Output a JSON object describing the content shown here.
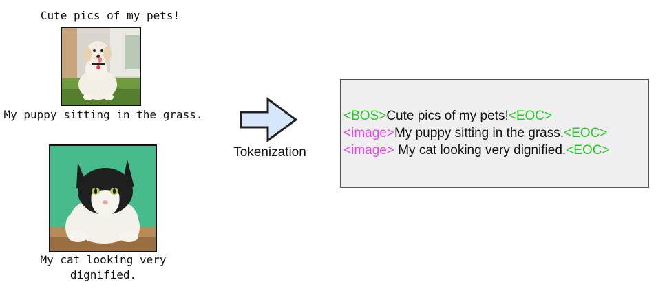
{
  "captions": {
    "title": "Cute pics of my pets!",
    "puppy": "My puppy sitting in the grass.",
    "cat": "My cat looking very dignified."
  },
  "process": {
    "label": "Tokenization"
  },
  "tokens": {
    "line1": {
      "bos": "<BOS>",
      "text": "Cute pics of my pets!",
      "eoc": "<EOC>"
    },
    "line2": {
      "image": "<image>",
      "text": "My puppy sitting in the grass.",
      "eoc": "<EOC>"
    },
    "line3": {
      "image": "<image>",
      "text": " My cat looking very dignified.",
      "eoc": "<EOC>"
    }
  },
  "colors": {
    "special_token": "#22cc22",
    "image_token": "#ee44ee",
    "arrow_fill": "#d6e6fb",
    "box_fill": "#efefef"
  },
  "icons": {
    "arrow": "right-arrow-icon"
  }
}
